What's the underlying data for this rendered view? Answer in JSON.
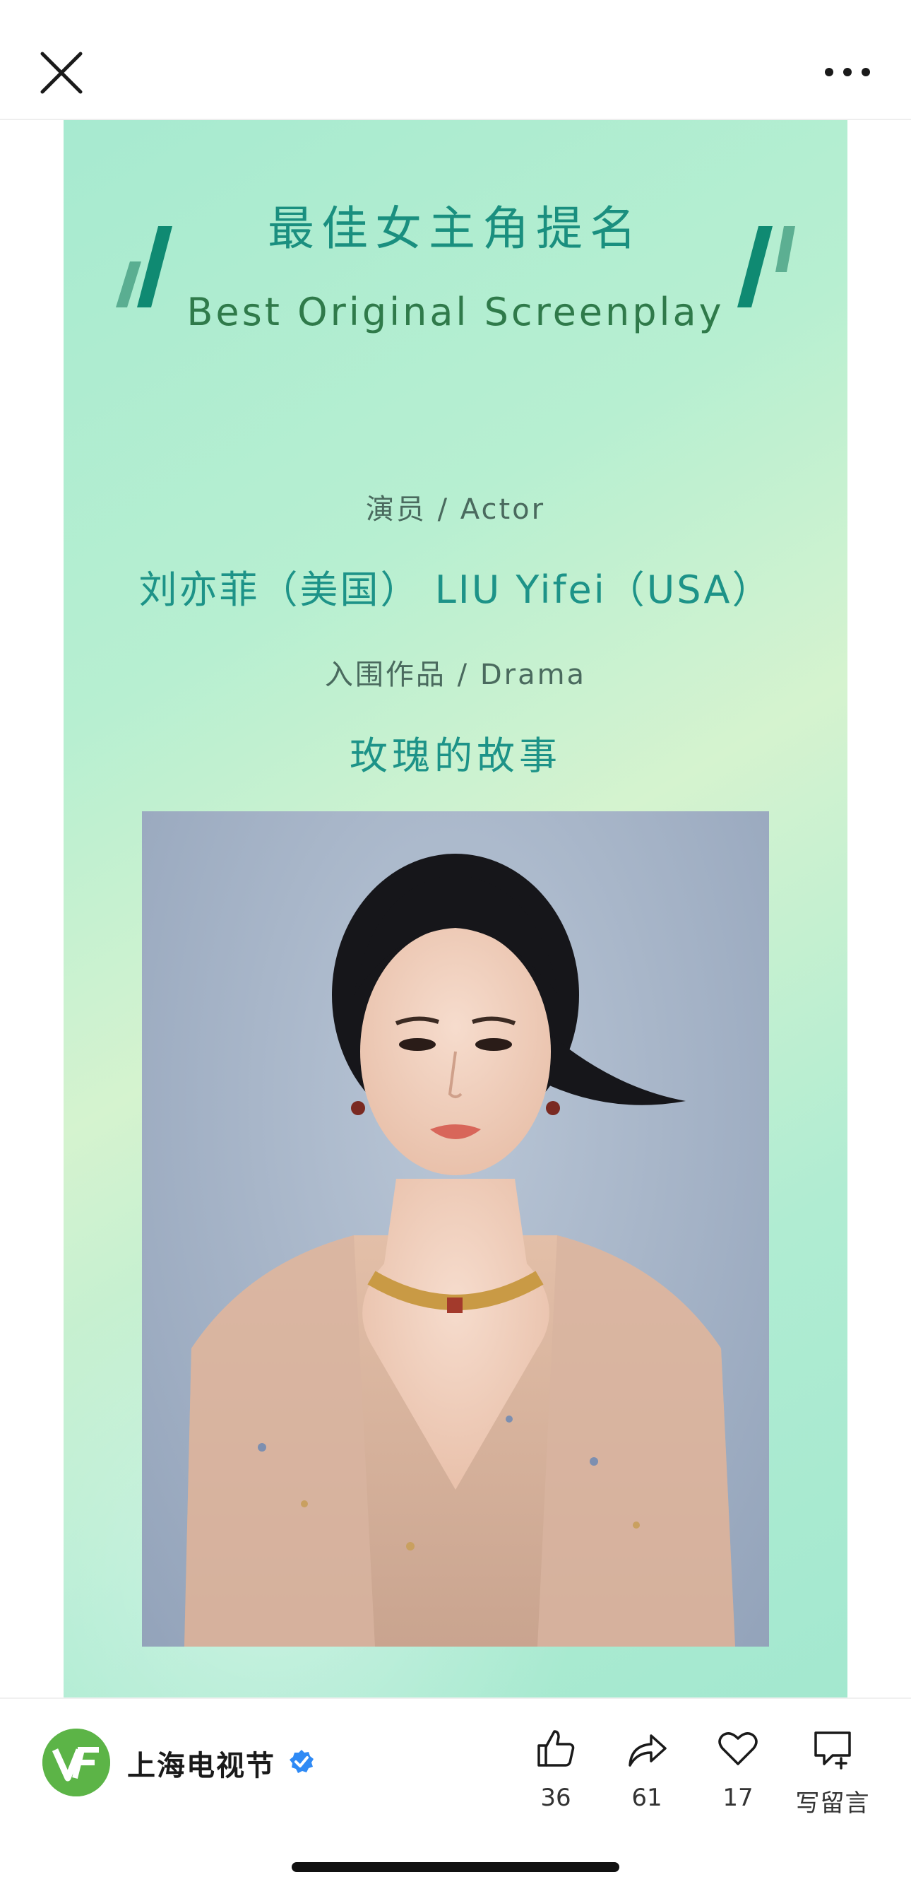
{
  "header": {
    "close_icon": "close-icon",
    "more_icon": "more-icon"
  },
  "poster": {
    "title_cn": "最佳女主角提名",
    "title_en": "Best Original Screenplay",
    "actor_label": "演员 / Actor",
    "actor_name": "刘亦菲（美国） LIU Yifei（USA）",
    "drama_label": "入围作品 / Drama",
    "drama_name": "玫瑰的故事",
    "colors": {
      "title": "#1a8f7f",
      "subtitle": "#2f7a4a",
      "accent": "#0f8a72",
      "background": "#b7efd1"
    }
  },
  "footer": {
    "account_name": "上海电视节",
    "verified_icon": "verified-badge-icon",
    "actions": [
      {
        "icon": "thumbs-up-icon",
        "label": "36"
      },
      {
        "icon": "share-icon",
        "label": "61"
      },
      {
        "icon": "heart-icon",
        "label": "17"
      },
      {
        "icon": "comment-add-icon",
        "label": "写留言"
      }
    ]
  }
}
